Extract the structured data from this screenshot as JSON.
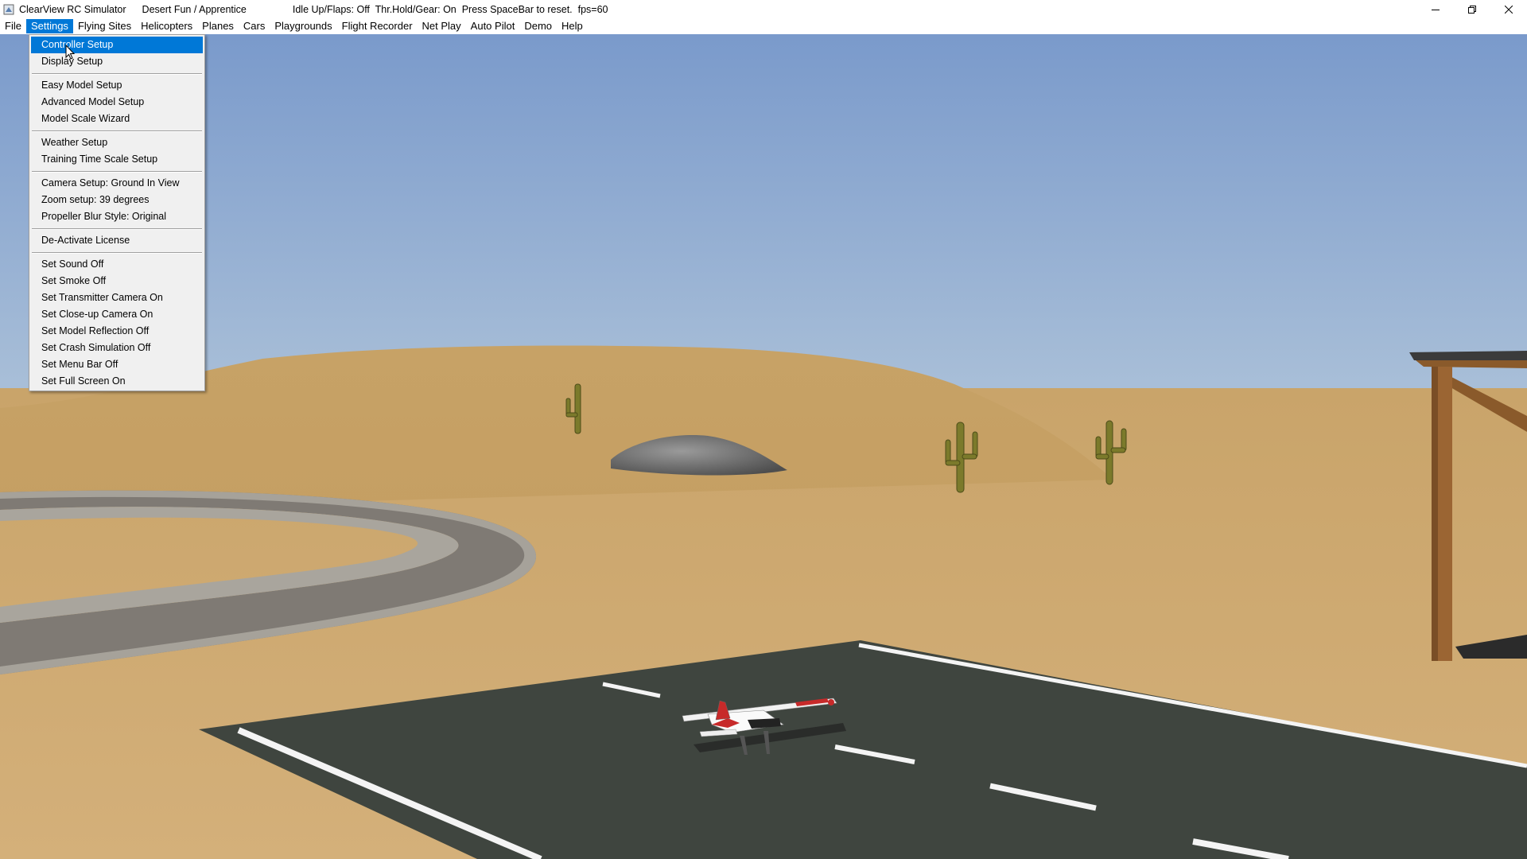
{
  "window": {
    "app_title": "ClearView RC Simulator",
    "site": "Desert Fun / Apprentice",
    "status": "Idle Up/Flaps: Off  Thr.Hold/Gear: On  Press SpaceBar to reset.  fps=60",
    "minimize_icon": "minimize-icon",
    "restore_icon": "restore-icon",
    "close_icon": "close-icon"
  },
  "menubar": {
    "items": [
      "File",
      "Settings",
      "Flying Sites",
      "Helicopters",
      "Planes",
      "Cars",
      "Playgrounds",
      "Flight Recorder",
      "Net Play",
      "Auto Pilot",
      "Demo",
      "Help"
    ],
    "active": "Settings"
  },
  "settings_menu": {
    "group1": [
      "Controller Setup",
      "Display Setup"
    ],
    "group2": [
      "Easy Model Setup",
      "Advanced Model Setup",
      "Model Scale Wizard"
    ],
    "group3": [
      "Weather Setup",
      "Training Time Scale Setup"
    ],
    "group4": [
      "Camera Setup: Ground In View",
      "Zoom setup: 39 degrees",
      "Propeller Blur Style: Original"
    ],
    "group5": [
      "De-Activate License"
    ],
    "group6": [
      "Set Sound Off",
      "Set Smoke Off",
      "Set Transmitter Camera On",
      "Set Close-up Camera On",
      "Set Model Reflection Off",
      "Set Crash Simulation Off",
      "Set Menu Bar Off",
      "Set Full Screen On"
    ],
    "highlighted": "Controller Setup"
  },
  "colors": {
    "accent": "#0078d7",
    "sky_top": "#7d9ccb",
    "sky_bottom": "#a6bcd6",
    "sand": "#c8a46a",
    "runway": "#3f453f",
    "track": "#7a7672"
  }
}
